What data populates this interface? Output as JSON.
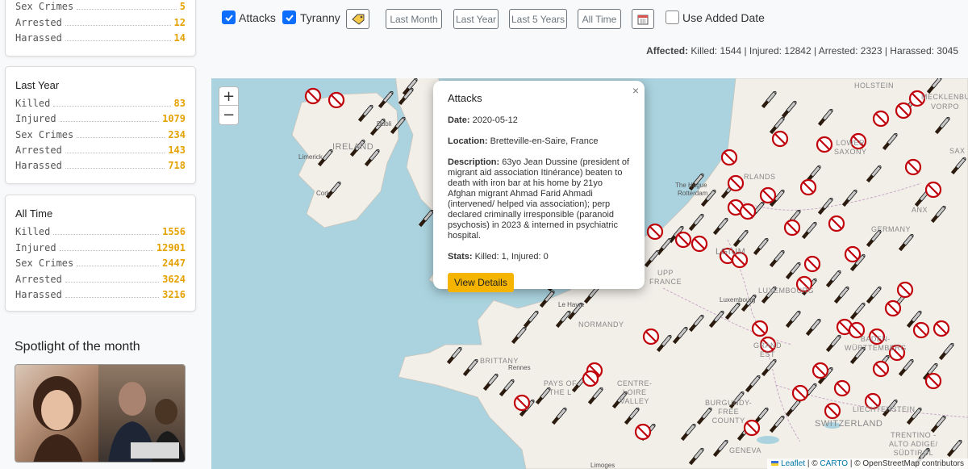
{
  "sidebar": {
    "card_top_partial": {
      "rows": [
        {
          "label": "Sex Crimes",
          "value": "5"
        },
        {
          "label": "Arrested",
          "value": "12"
        },
        {
          "label": "Harassed",
          "value": "14"
        }
      ]
    },
    "card_last_year": {
      "title": "Last Year",
      "rows": [
        {
          "label": "Killed",
          "value": "83"
        },
        {
          "label": "Injured",
          "value": "1079"
        },
        {
          "label": "Sex Crimes",
          "value": "234"
        },
        {
          "label": "Arrested",
          "value": "143"
        },
        {
          "label": "Harassed",
          "value": "718"
        }
      ]
    },
    "card_all_time": {
      "title": "All Time",
      "rows": [
        {
          "label": "Killed",
          "value": "1556"
        },
        {
          "label": "Injured",
          "value": "12901"
        },
        {
          "label": "Sex Crimes",
          "value": "2447"
        },
        {
          "label": "Arrested",
          "value": "3624"
        },
        {
          "label": "Harassed",
          "value": "3216"
        }
      ]
    },
    "spotlight_title": "Spotlight of the month"
  },
  "toolbar": {
    "attacks_label": "Attacks",
    "tyranny_label": "Tyranny",
    "last_month": "Last Month",
    "last_year": "Last Year",
    "last_5_years": "Last 5 Years",
    "all_time": "All Time",
    "use_added_date": "Use Added Date",
    "affected_label": "Affected:",
    "affected_values": "Killed: 1544 | Injured: 12842 | Arrested: 2323 | Harassed: 3045"
  },
  "map": {
    "zoom_in": "+",
    "zoom_out": "−",
    "places": {
      "dublin": "Dubli",
      "ireland": "IRELAND",
      "limerick": "Limerick",
      "cork": "Cork",
      "holstein": "HOLSTEIN",
      "mecklenbu": "MECKLENBU",
      "vorpo": "VORPO",
      "lower_saxony": "LOWER\nSAXONY",
      "sax": "SAX",
      "netherlands": "RLANDS",
      "the_hague": "The Hague",
      "rotterdam": "Rotterdam",
      "germany": "GERMANY",
      "anx": "ANX",
      "belgium": "LGIUM",
      "luxembourg": "LUXEMBOURG",
      "luxembourg_city": "Luxembourg",
      "upper_france": "UPP\nFRANCE",
      "le_havre": "Le Havre",
      "normandy": "NORMANDY",
      "grand_est": "GRAND\nEST",
      "baden": "BADEN-\nWÜRTTEMBERG",
      "brittany": "BRITTANY",
      "rennes": "Rennes",
      "pays_de_la_loire": "PAYS OF\nTHE L",
      "centre": "CENTRE-\nLOIRE\nVALLEY",
      "burgundy": "BURGUNDY-\nFREE\nCOUNTY",
      "switzerland": "SWITZERLAND",
      "liechtenstein": "LIECHTENSTEIN",
      "trentino": "TRENTINO -\nALTO ADIGE/\nSÜDTIROL",
      "geneva": "GENEVA",
      "limoges": "Limoges"
    },
    "attribution": {
      "leaflet": "Leaflet",
      "carto": "CARTO",
      "osm": "© OpenStreetMap contributors"
    }
  },
  "popup": {
    "title": "Attacks",
    "date_label": "Date:",
    "date": "2020-05-12",
    "location_label": "Location:",
    "location": "Bretteville-en-Saire, France",
    "description_label": "Description:",
    "description": "63yo Jean Dussine (president of migrant aid association Itinérance) beaten to death with iron bar at his home by 21yo Afghan migrant Ahmad Farid Ahmadi (intervened/ helped via association); perp declared criminally irresponsible (paranoid psychosis) in 2023 & interned in psychiatric hospital.",
    "stats_label": "Stats:",
    "stats": "Killed: 1, Injured: 0",
    "button": "View Details",
    "close": "×"
  },
  "colors": {
    "accent_yellow": "#f4b400",
    "stat_value": "#e5a100",
    "checkbox_blue": "#0d6efd",
    "prohibited_red": "#c0000a",
    "knife_blade": "#c8c8c8",
    "knife_handle": "#2b1a0e",
    "water": "#aad3df",
    "land": "#f2efe9"
  },
  "icons": {
    "attack_marker": "knife-icon",
    "tyranny_marker": "prohibited-icon",
    "tag_button": "tag-icon",
    "calendar_button": "calendar-icon"
  }
}
